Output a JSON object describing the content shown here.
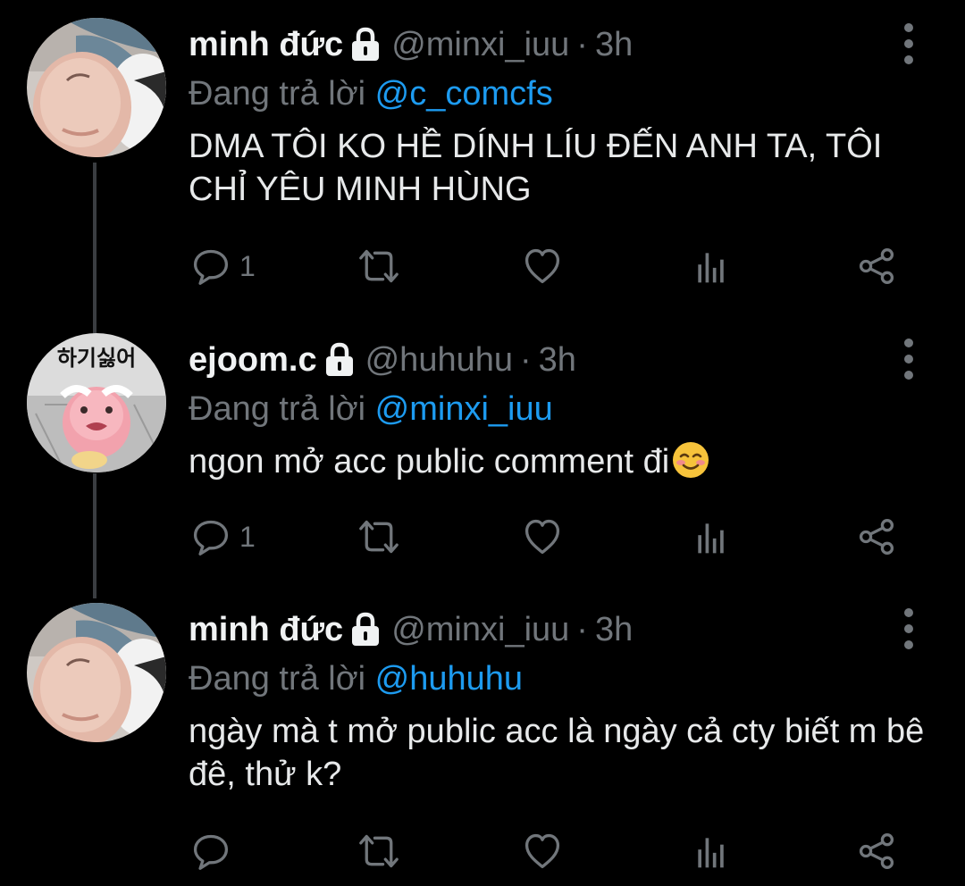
{
  "colors": {
    "background": "#000000",
    "primary_text": "#e7e9ea",
    "secondary_text": "#71767b",
    "mention": "#1d9bf0",
    "thread_line": "#3a3d41"
  },
  "icons": {
    "reply": "speech-bubble-icon",
    "retweet": "retweet-arrows-icon",
    "like": "heart-icon",
    "analytics": "bar-chart-icon",
    "share": "share-icon",
    "protected": "lock-icon",
    "more": "vertical-dots-icon"
  },
  "tweets": [
    {
      "name": "minh đức",
      "handle": "@minxi_iuu",
      "dot": "·",
      "time": "3h",
      "reply_prefix": "Đang trả lời",
      "reply_to": "@c_comcfs",
      "text": "DMA TÔI KO HỀ DÍNH LÍU ĐẾN ANH TA, TÔI CHỈ YÊU MINH HÙNG",
      "reply_count": "1",
      "protected": true
    },
    {
      "name": "ejoom.c",
      "handle": "@huhuhu",
      "dot": "·",
      "time": "3h",
      "reply_prefix": "Đang trả lời",
      "reply_to": "@minxi_iuu",
      "text": "ngon mở acc public comment đi",
      "emoji": "smiling-face-emoji",
      "avatar_text": "하기싫어",
      "reply_count": "1",
      "protected": true
    },
    {
      "name": "minh đức",
      "handle": "@minxi_iuu",
      "dot": "·",
      "time": "3h",
      "reply_prefix": "Đang trả lời",
      "reply_to": "@huhuhu",
      "text": "ngày mà t mở public acc là ngày cả cty biết m bê đê, thử k?",
      "reply_count": "",
      "protected": true
    }
  ]
}
